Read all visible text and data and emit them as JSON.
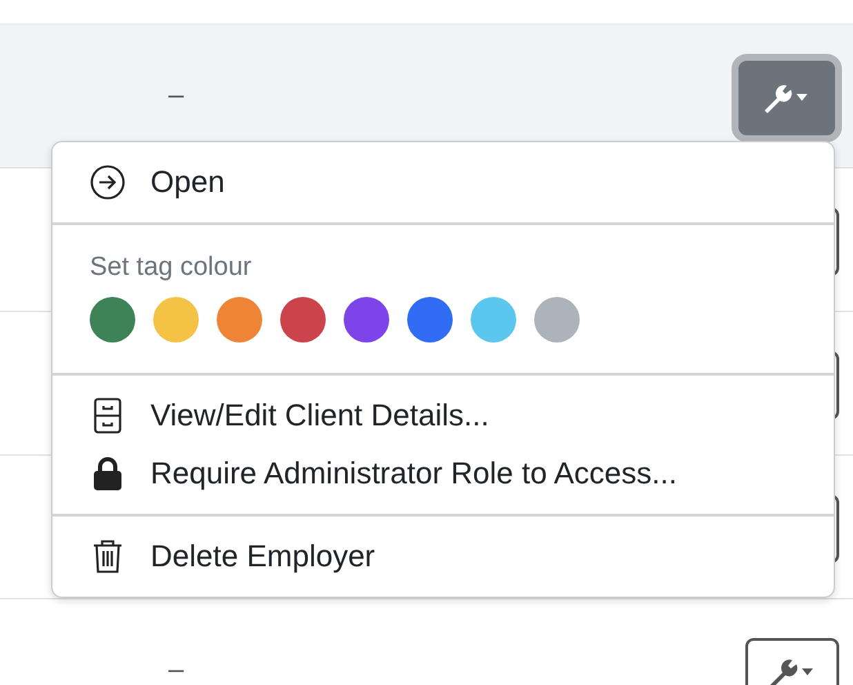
{
  "rows": [
    {
      "cell": "–",
      "selected": true,
      "menu_open": true
    },
    {
      "selected": false,
      "menu_open": false
    },
    {
      "selected": false,
      "menu_open": false
    },
    {
      "selected": false,
      "menu_open": false
    },
    {
      "cell": "–",
      "selected": false,
      "menu_open": false
    }
  ],
  "menu": {
    "sections": [
      {
        "items": [
          {
            "kind": "open",
            "label": "Open"
          }
        ]
      },
      {
        "heading": "Set tag colour",
        "colors": [
          {
            "color": "#3e8357"
          },
          {
            "color": "#f4c244"
          },
          {
            "color": "#ee8536"
          },
          {
            "color": "#cc444b"
          },
          {
            "color": "#7d45e9"
          },
          {
            "color": "#316cf4"
          },
          {
            "color": "#5bc7ee"
          },
          {
            "color": "#adb3ba"
          }
        ]
      },
      {
        "items": [
          {
            "kind": "details",
            "label": "View/Edit Client Details..."
          },
          {
            "kind": "lock",
            "label": "Require Administrator Role to Access..."
          }
        ]
      },
      {
        "items": [
          {
            "kind": "delete",
            "label": "Delete Employer"
          }
        ]
      }
    ]
  }
}
